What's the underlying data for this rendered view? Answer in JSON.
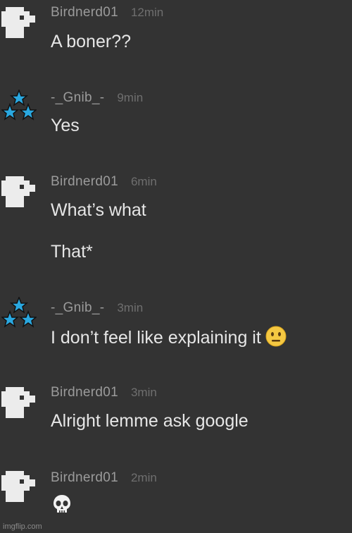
{
  "messages": [
    {
      "user": "Birdnerd01",
      "time": "12min",
      "lines": [
        "A boner??"
      ]
    },
    {
      "user": "-_Gnib_-",
      "time": "9min",
      "lines": [
        "Yes"
      ]
    },
    {
      "user": "Birdnerd01",
      "time": "6min",
      "lines": [
        "What’s what",
        "That*"
      ]
    },
    {
      "user": "-_Gnib_-",
      "time": "3min",
      "lines": [
        "I don’t feel like explaining it"
      ],
      "emoji": "neutral-face-icon"
    },
    {
      "user": "Birdnerd01",
      "time": "3min",
      "lines": [
        "Alright lemme ask google"
      ]
    },
    {
      "user": "Birdnerd01",
      "time": "2min",
      "lines": [],
      "emoji": "skull-icon"
    }
  ],
  "watermark": "imgflip.com",
  "colors": {
    "background": "#333333",
    "username": "#9b9b9b",
    "timestamp": "#6f6f6f",
    "message_text": "#e6e6e6",
    "star_blue": "#2aa8e0"
  }
}
